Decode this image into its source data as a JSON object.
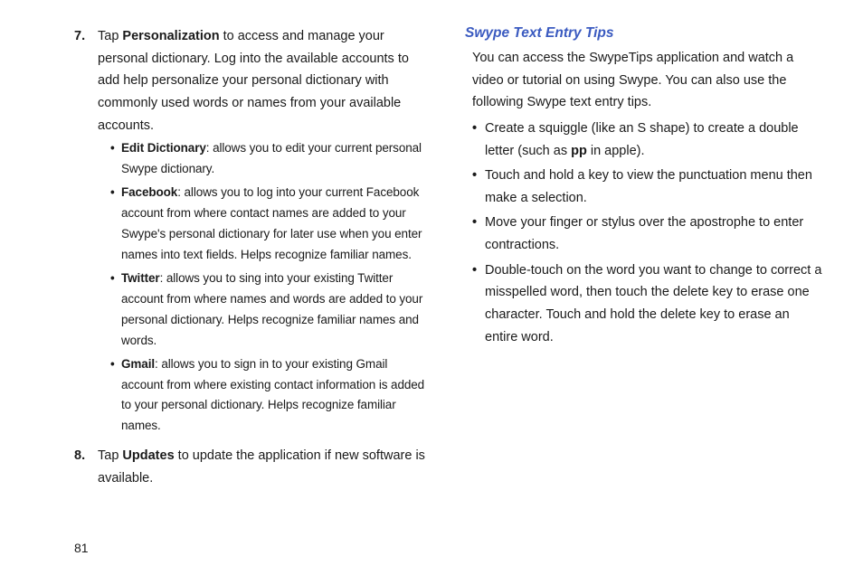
{
  "left": {
    "item7": {
      "num": "7.",
      "lead": "Tap ",
      "bold": "Personalization",
      "rest": " to access and manage your personal dictionary. Log into the available accounts to add help personalize your personal dictionary with commonly used words or names from your available accounts.",
      "subs": [
        {
          "bold": "Edit Dictionary",
          "rest": ": allows you to edit your current personal Swype dictionary."
        },
        {
          "bold": "Facebook",
          "rest": ": allows you to log into your current Facebook account from where contact names are added to your Swype's personal dictionary for later use when you enter names into text fields. Helps recognize familiar names."
        },
        {
          "bold": "Twitter",
          "rest": ": allows you to sing into your existing Twitter account from where names and words are added to your personal dictionary. Helps recognize familiar names and words."
        },
        {
          "bold": "Gmail",
          "rest": ": allows you to sign in to your existing Gmail account from where existing contact information is added to your personal dictionary. Helps recognize familiar names."
        }
      ]
    },
    "item8": {
      "num": "8.",
      "lead": "Tap ",
      "bold": "Updates",
      "rest": " to update the application if new software is available."
    }
  },
  "right": {
    "heading": "Swype Text Entry Tips",
    "para": "You can access the SwypeTips application and watch a video or tutorial on using Swype. You can also use the following Swype text entry tips.",
    "tips": [
      {
        "pre": "Create a squiggle (like an S shape) to create a double letter (such as ",
        "bold": "pp",
        "post": " in apple)."
      },
      {
        "pre": "Touch and hold a key to view the punctuation menu then make a selection.",
        "bold": "",
        "post": ""
      },
      {
        "pre": "Move your finger or stylus over the apostrophe to enter contractions.",
        "bold": "",
        "post": ""
      },
      {
        "pre": "Double-touch on the word you want to change to correct a misspelled word, then touch the delete key to erase one character. Touch and hold the delete key to erase an entire word.",
        "bold": "",
        "post": ""
      }
    ]
  },
  "pageNumber": "81",
  "bullet": "•"
}
